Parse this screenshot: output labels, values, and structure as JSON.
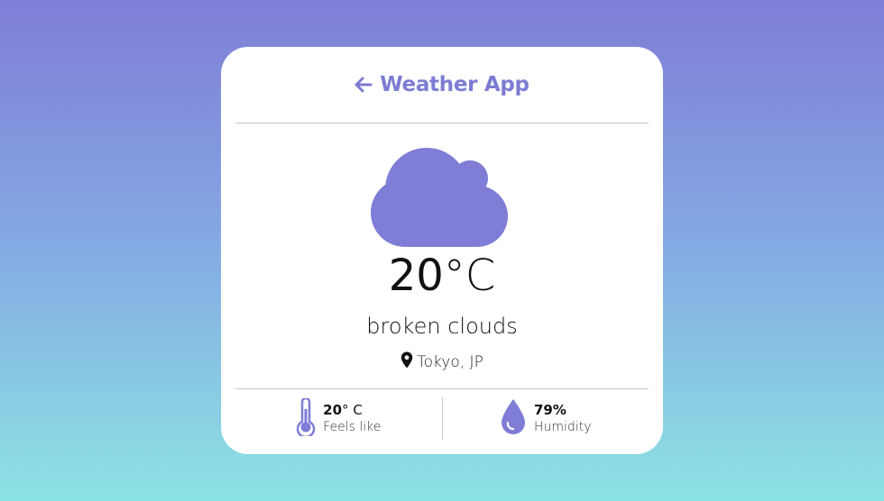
{
  "app": {
    "title": "Weather App"
  },
  "icons": {
    "back": "arrow-left-icon",
    "weather": "cloud-icon",
    "location": "map-pin-icon",
    "feels_like": "thermometer-icon",
    "humidity": "water-drop-icon"
  },
  "colors": {
    "accent": "#7c7cd4",
    "gradient_top": "#7f7dd6",
    "gradient_bottom": "#8ce3e3",
    "card": "#ffffff"
  },
  "weather": {
    "temp_value": "20",
    "temp_unit": "°C",
    "description": "broken clouds",
    "location": "Tokyo, JP"
  },
  "stats": {
    "feels_like": {
      "value": "20",
      "unit": "° C",
      "label": "Feels like"
    },
    "humidity": {
      "value": "79%",
      "label": "Humidity"
    }
  }
}
